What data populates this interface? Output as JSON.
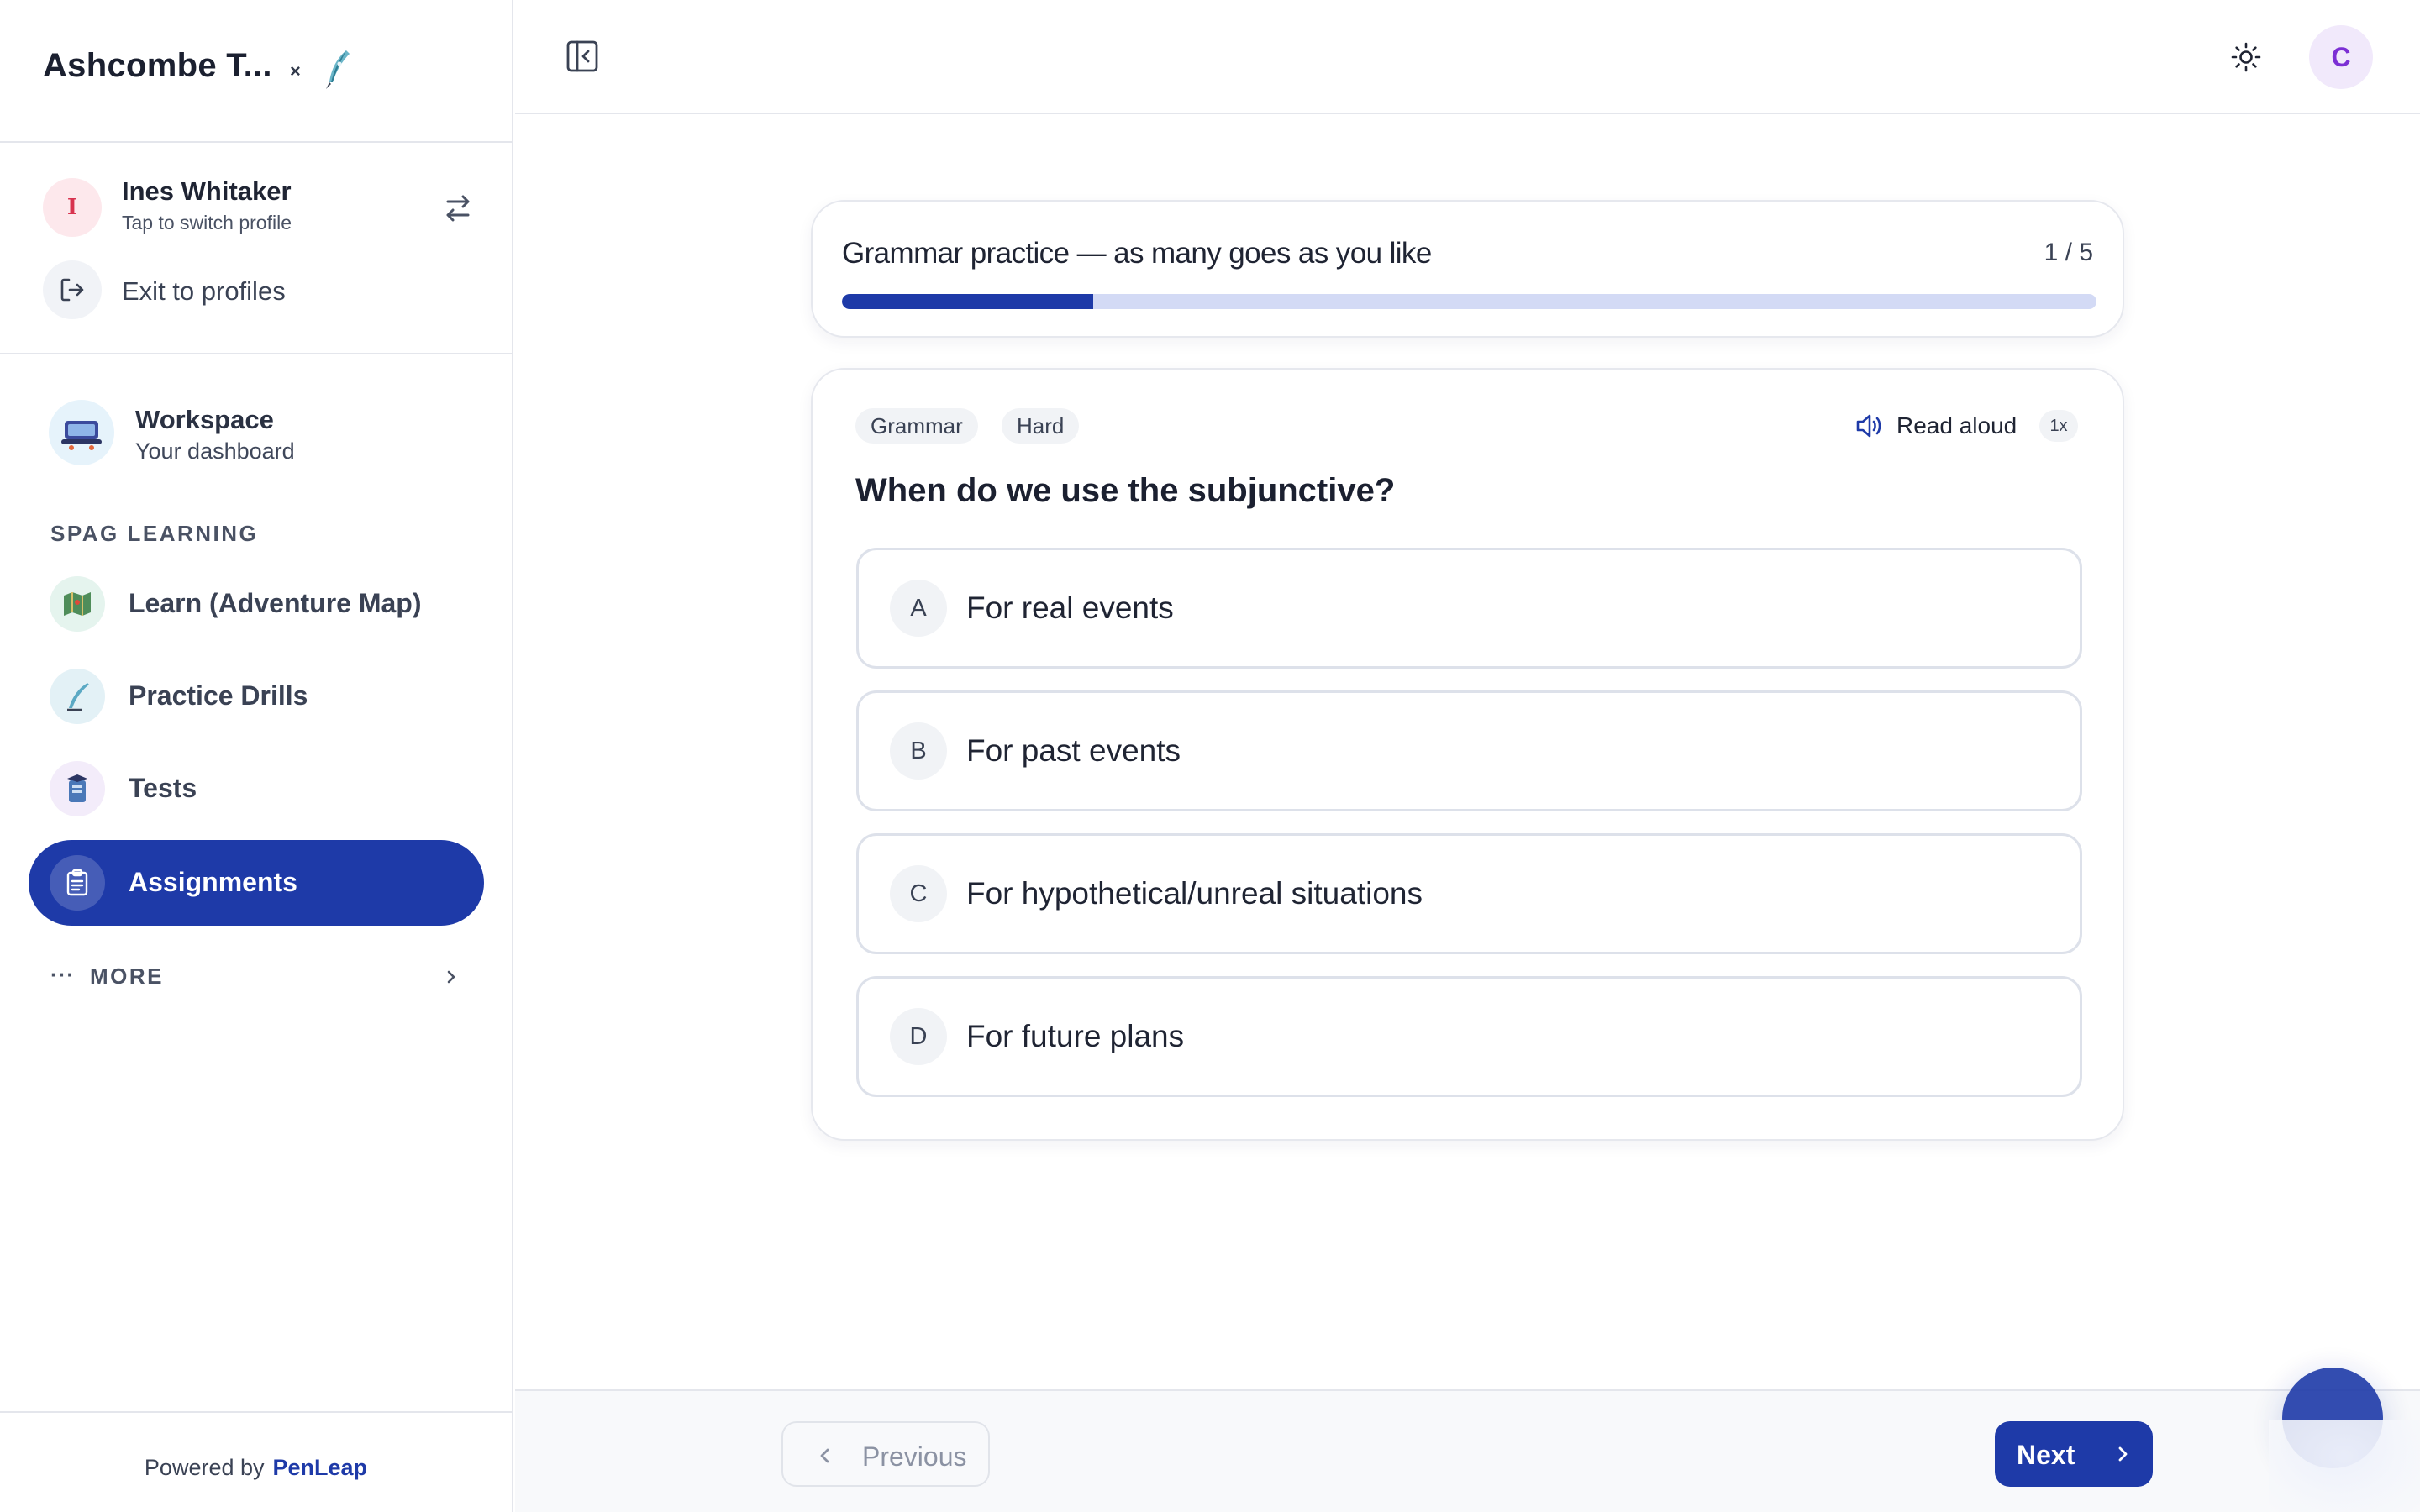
{
  "sidebar": {
    "brand_title": "Ashcombe T...",
    "brand_close": "×",
    "profile": {
      "initial": "I",
      "name": "Ines Whitaker",
      "subtitle": "Tap to switch profile",
      "exit_label": "Exit to profiles"
    },
    "workspace": {
      "title": "Workspace",
      "subtitle": "Your dashboard"
    },
    "section_label": "SPAG LEARNING",
    "items": [
      {
        "label": "Learn (Adventure Map)",
        "icon": "map-icon"
      },
      {
        "label": "Practice Drills",
        "icon": "quill-icon"
      },
      {
        "label": "Tests",
        "icon": "test-icon"
      },
      {
        "label": "Assignments",
        "icon": "clipboard-icon",
        "active": true
      }
    ],
    "more": {
      "dots": "···",
      "label": "MORE"
    },
    "footer": {
      "prefix": "Powered by",
      "brand": "PenLeap"
    }
  },
  "header": {
    "user_initial": "C"
  },
  "practice": {
    "title": "Grammar practice — as many goes as you like",
    "count": "1 / 5",
    "progress": 0.2
  },
  "question": {
    "tags": [
      "Grammar",
      "Hard"
    ],
    "read_aloud": "Read aloud",
    "speed": "1x",
    "text": "When do we use the subjunctive?",
    "options": [
      {
        "letter": "A",
        "text": "For real events"
      },
      {
        "letter": "B",
        "text": "For past events"
      },
      {
        "letter": "C",
        "text": "For hypothetical/unreal situations"
      },
      {
        "letter": "D",
        "text": "For future plans"
      }
    ]
  },
  "navigation": {
    "previous": "Previous",
    "next": "Next"
  },
  "colors": {
    "accent": "#1e3aa8",
    "progress_track": "#d3daf5",
    "avatar_user_bg": "#f1e9fb",
    "avatar_user_fg": "#7c2fd4",
    "avatar_profile_fg": "#d8334f"
  }
}
